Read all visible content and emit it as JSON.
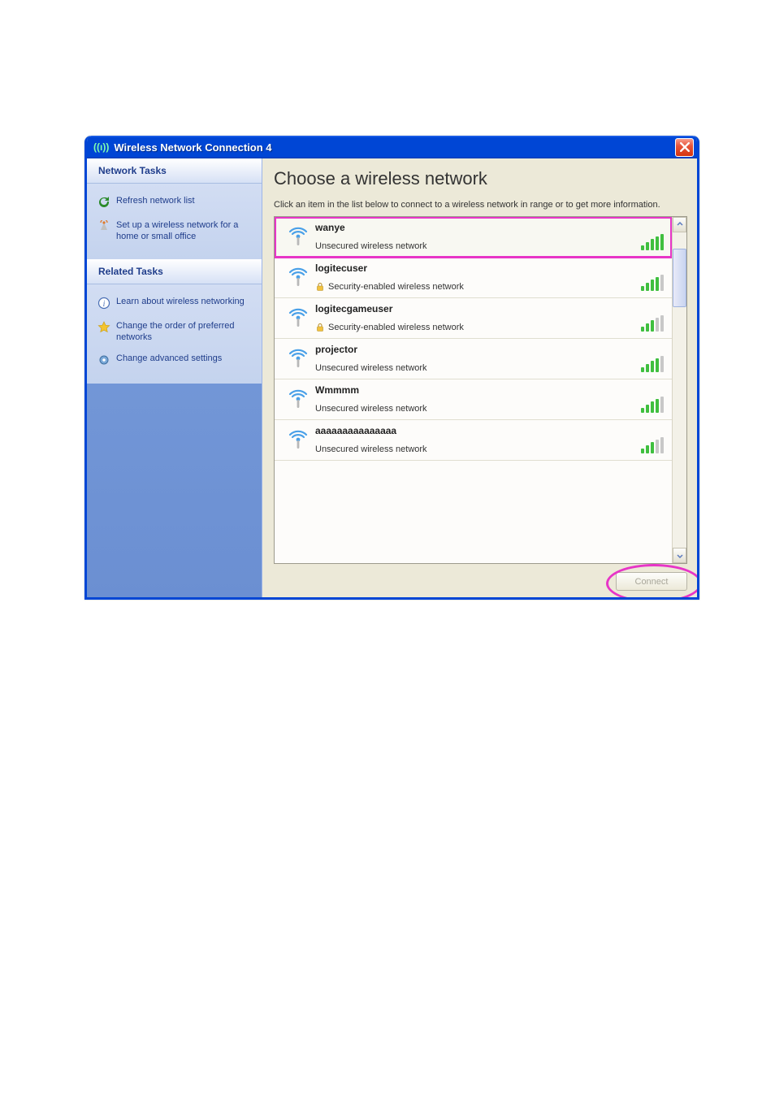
{
  "window": {
    "title": "Wireless Network Connection 4"
  },
  "sidebar": {
    "panel1": {
      "title": "Network Tasks",
      "items": [
        {
          "label": "Refresh network list"
        },
        {
          "label": "Set up a wireless network for a home or small office"
        }
      ]
    },
    "panel2": {
      "title": "Related Tasks",
      "items": [
        {
          "label": "Learn about wireless networking"
        },
        {
          "label": "Change the order of preferred networks"
        },
        {
          "label": "Change advanced settings"
        }
      ]
    }
  },
  "main": {
    "heading": "Choose a wireless network",
    "instructions": "Click an item in the list below to connect to a wireless network in range or to get more information.",
    "connect_label": "Connect",
    "statuses": {
      "unsecured": "Unsecured wireless network",
      "secured": "Security-enabled wireless network"
    },
    "networks": [
      {
        "name": "wanye",
        "secure": false,
        "signal": 5,
        "selected": true
      },
      {
        "name": "logitecuser",
        "secure": true,
        "signal": 4,
        "selected": false
      },
      {
        "name": "logitecgameuser",
        "secure": true,
        "signal": 3,
        "selected": false
      },
      {
        "name": "projector",
        "secure": false,
        "signal": 4,
        "selected": false
      },
      {
        "name": "Wmmmm",
        "secure": false,
        "signal": 4,
        "selected": false
      },
      {
        "name": "aaaaaaaaaaaaaaa",
        "secure": false,
        "signal": 3,
        "selected": false
      }
    ]
  }
}
